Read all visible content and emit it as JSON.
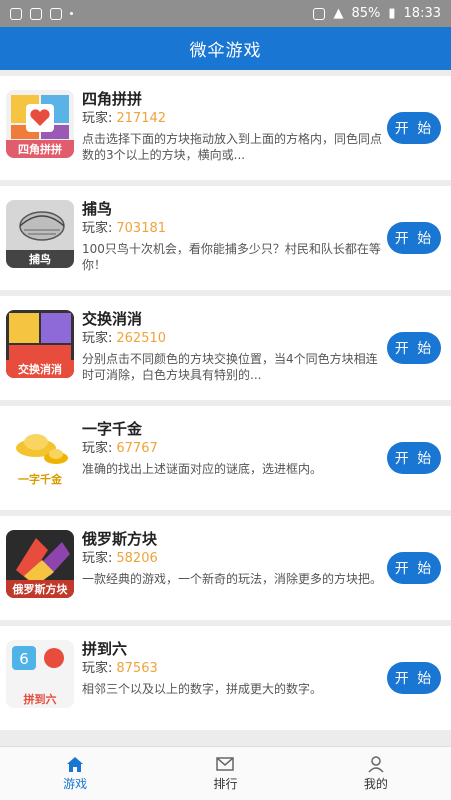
{
  "status_bar": {
    "battery": "85%",
    "time": "18:33"
  },
  "app_bar": {
    "title": "微伞游戏"
  },
  "player_label": "玩家:",
  "play_label": "开 始",
  "games": [
    {
      "title": "四角拼拼",
      "players": "217142",
      "desc": "点击选择下面的方块拖动放入到上面的方格内，同色同点数的3个以上的方块，横向或...",
      "thumb_label": "四角拼拼",
      "icon": "heart-icon"
    },
    {
      "title": "捕鸟",
      "players": "703181",
      "desc": "100只鸟十次机会，看你能捕多少只？村民和队长都在等你！",
      "thumb_label": "捕鸟",
      "icon": "bird-icon"
    },
    {
      "title": "交换消消",
      "players": "262510",
      "desc": "分别点击不同颜色的方块交换位置，当4个同色方块相连时可消除，白色方块具有特别的...",
      "thumb_label": "交换消消",
      "icon": "blocks-icon"
    },
    {
      "title": "一字千金",
      "players": "67767",
      "desc": "准确的找出上述谜面对应的谜底，选进框内。",
      "thumb_label": "一字千金",
      "icon": "gold-icon"
    },
    {
      "title": "俄罗斯方块",
      "players": "58206",
      "desc": "一款经典的游戏，一个新奇的玩法，消除更多的方块把。",
      "thumb_label": "俄罗斯方块",
      "icon": "tetris-icon"
    },
    {
      "title": "拼到六",
      "players": "87563",
      "desc": "相邻三个以及以上的数字，拼成更大的数字。",
      "thumb_label": "拼到六",
      "icon": "six-icon"
    }
  ],
  "tabs": [
    {
      "label": "游戏",
      "icon": "home-icon"
    },
    {
      "label": "排行",
      "icon": "mail-icon"
    },
    {
      "label": "我的",
      "icon": "user-icon"
    }
  ]
}
